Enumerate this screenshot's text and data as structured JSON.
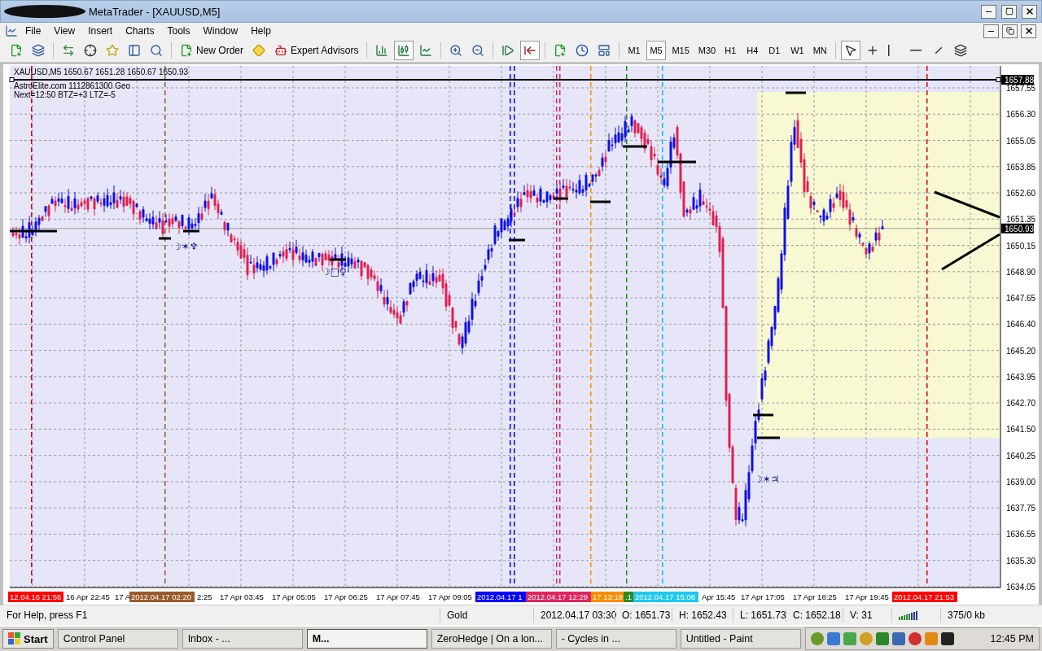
{
  "window": {
    "title": "MetaTrader - [XAUUSD,M5]"
  },
  "menu": [
    "File",
    "View",
    "Insert",
    "Charts",
    "Tools",
    "Window",
    "Help"
  ],
  "toolbar": {
    "new_order": "New Order",
    "expert_advisors": "Expert Advisors",
    "chart_types": [
      {
        "selected": false
      },
      {
        "selected": true
      },
      {
        "selected": false
      }
    ],
    "timeframes": [
      {
        "label": "M1",
        "selected": false
      },
      {
        "label": "M5",
        "selected": true
      },
      {
        "label": "M15",
        "selected": false
      },
      {
        "label": "M30",
        "selected": false
      },
      {
        "label": "H1",
        "selected": false
      },
      {
        "label": "H4",
        "selected": false
      },
      {
        "label": "D1",
        "selected": false
      },
      {
        "label": "W1",
        "selected": false
      },
      {
        "label": "MN",
        "selected": false
      }
    ],
    "drawing_tools": [
      {
        "selected": true
      },
      {
        "selected": false
      },
      {
        "selected": false
      },
      {
        "selected": false
      },
      {
        "selected": false
      },
      {
        "selected": false
      }
    ]
  },
  "chart": {
    "header": "XAUUSD,M5  1650.67 1651.28 1650.67 1650.93",
    "lines": [
      "AstroElite.com 1112861300 Geo",
      "Next=12:50 BTZ=+3 LTZ=-5"
    ],
    "price_labels": [
      "1657.55",
      "1656.30",
      "1655.05",
      "1653.85",
      "1652.60",
      "1651.35",
      "1650.15",
      "1648.90",
      "1647.65",
      "1646.40",
      "1645.20",
      "1643.95",
      "1642.70",
      "1641.50",
      "1640.25",
      "1639.00",
      "1637.75",
      "1636.55",
      "1635.30",
      "1634.05"
    ],
    "price_tags": [
      "1657.88",
      "1650.93"
    ],
    "aspects": [
      "☽✶♆",
      "☽□♀",
      "☽✶♃"
    ],
    "markers": [
      {
        "color": "#e00000"
      },
      {
        "color": "#a0522d"
      },
      {
        "color": "#0000ff"
      },
      {
        "color": "#0000ff"
      },
      {
        "color": "#e0245e"
      },
      {
        "color": "#e0245e"
      },
      {
        "color": "#ff8c00"
      },
      {
        "color": "#228b22"
      },
      {
        "color": "#00bfff"
      },
      {
        "color": "#e00000"
      }
    ],
    "time_labels": [
      {
        "text": "12.04.16 21:56",
        "color": "#ff0000"
      },
      {
        "text": "16 Apr 22:45"
      },
      {
        "text": "17 A"
      },
      {
        "text": "2012.04.17 02:20",
        "color": "#9c5a2a"
      },
      {
        "text": "2:25"
      },
      {
        "text": "17 Apr 03:45"
      },
      {
        "text": "17 Apr 05:05"
      },
      {
        "text": "17 Apr 06:25"
      },
      {
        "text": "17 Apr 07:45"
      },
      {
        "text": "17 Apr 09:05"
      },
      {
        "text": "2012.04.17 1",
        "color": "#0000ff"
      },
      {
        "text": "2012.04.17 12:29",
        "color": "#e0245e"
      },
      {
        "text": "17 13:18",
        "color": "#ff8c00"
      },
      {
        "text": ".1",
        "color": "#2e8b22"
      },
      {
        "text": "2012.04.17 15:08",
        "color": "#1ec8f0"
      },
      {
        "text": "Apr 15:45"
      },
      {
        "text": "17 Apr 17:05"
      },
      {
        "text": "17 Apr 18:25"
      },
      {
        "text": "17 Apr 19:45"
      },
      {
        "text": "2012.04.17 21:53",
        "color": "#ff0000"
      }
    ]
  },
  "status_bar": [
    "For Help, press F1",
    "Gold",
    "2012.04.17 03:30",
    "O: 1651.73",
    "H: 1652.43",
    "L: 1651.73",
    "C: 1652.18",
    "V: 31",
    "375/0 kb"
  ],
  "taskbar": {
    "start": "Start",
    "buttons": [
      {
        "label": "Control Panel",
        "selected": false
      },
      {
        "label": "Inbox - ...",
        "selected": false
      },
      {
        "label": "M...",
        "selected": true
      },
      {
        "label": "ZeroHedge | On a lon...",
        "selected": false
      },
      {
        "label": "- Cycles in ...",
        "selected": false
      },
      {
        "label": "Untitled - Paint",
        "selected": false
      }
    ],
    "clock": "12:45 PM"
  }
}
